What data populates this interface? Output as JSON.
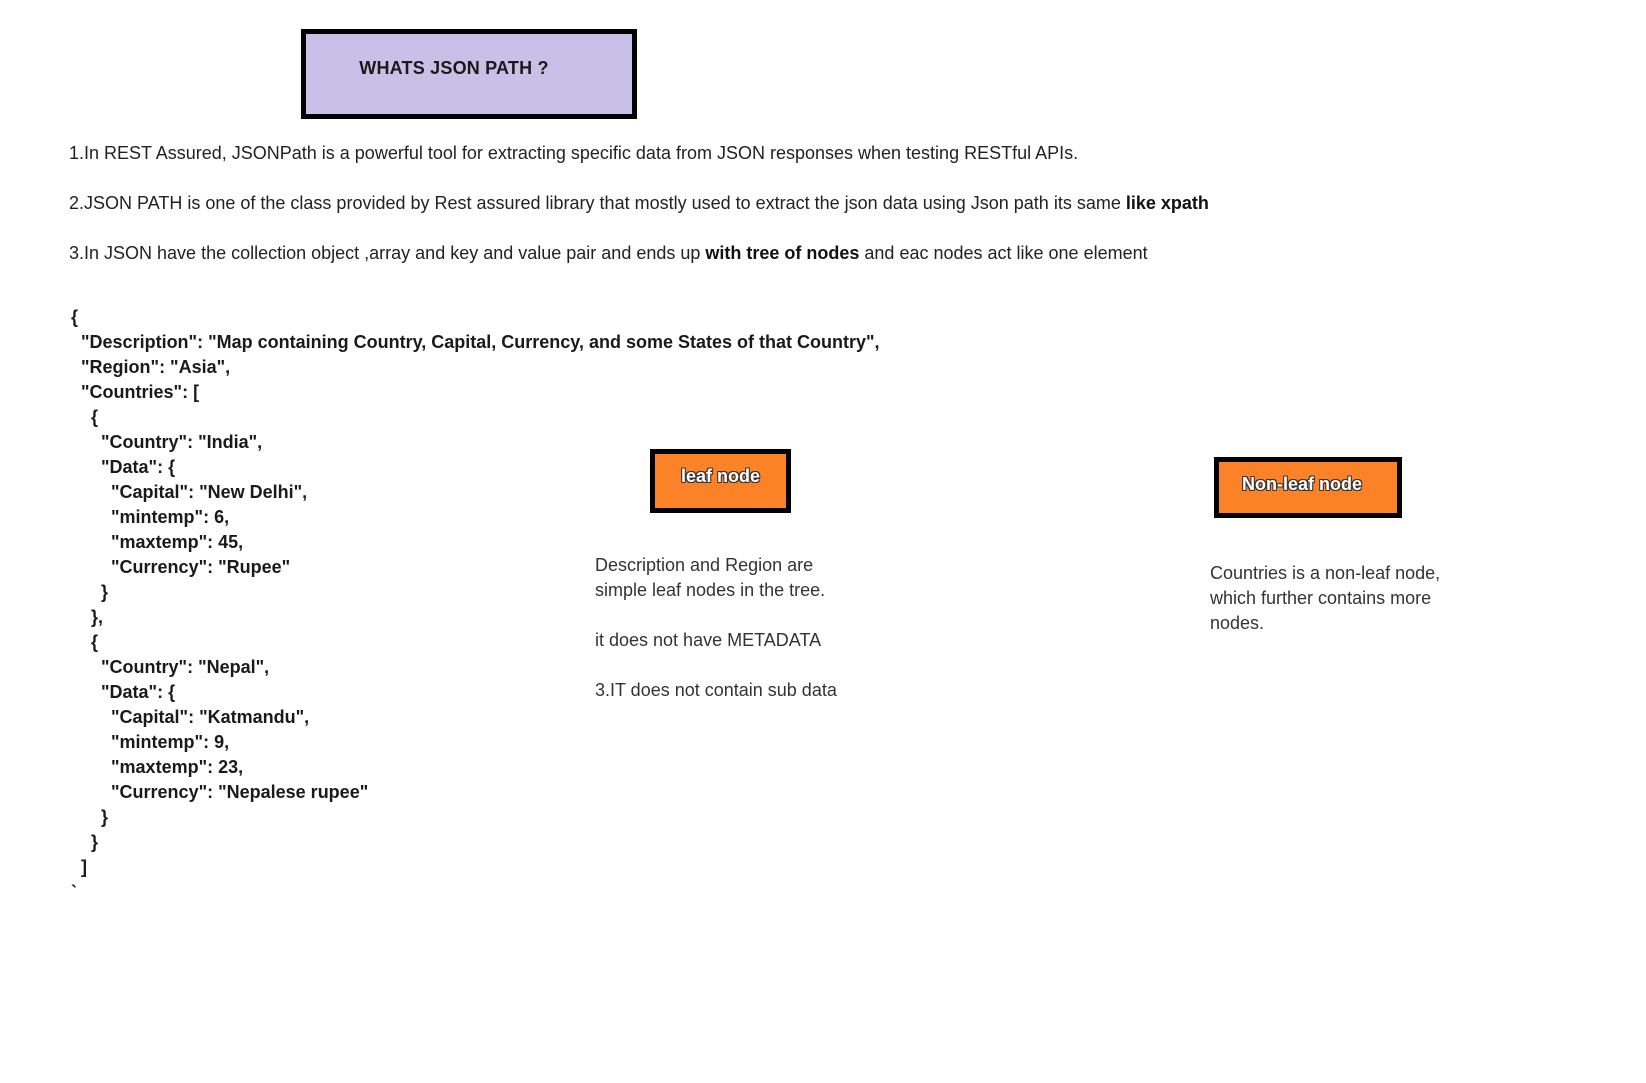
{
  "title": "WHATS JSON PATH ?",
  "points": {
    "p1": "1.In REST Assured, JSONPath is a powerful tool for extracting specific data from JSON responses when testing RESTful APIs.",
    "p2_text": "2.JSON PATH is one of the class provided by Rest assured library that mostly used to extract the json data  using Json path its same ",
    "p2_bold": "like xpath",
    "p3_pre": "3.In JSON have the collection object ,array and key and value pair and ends up ",
    "p3_bold": "with tree of nodes",
    "p3_post": " and eac  nodes act like one element"
  },
  "json_example": "{\n  \"Description\": \"Map containing Country, Capital, Currency, and some States of that Country\",\n  \"Region\": \"Asia\",\n  \"Countries\": [\n    {\n      \"Country\": \"India\",\n      \"Data\": {\n        \"Capital\": \"New Delhi\",\n        \"mintemp\": 6,\n        \"maxtemp\": 45,\n        \"Currency\": \"Rupee\"\n      }\n    },\n    {\n      \"Country\": \"Nepal\",\n      \"Data\": {\n        \"Capital\": \"Katmandu\",\n        \"mintemp\": 9,\n        \"maxtemp\": 23,\n        \"Currency\": \"Nepalese rupee\"\n      }\n    }\n  ]\n`",
  "leaf": {
    "label": "leaf node",
    "line1": "Description and Region are",
    "line2": "simple leaf nodes in the tree.",
    "line3": "it does not have METADATA",
    "line4": "3.IT does not contain sub data"
  },
  "nonleaf": {
    "label": "Non-leaf node",
    "line1": "Countries is a non-leaf node,",
    "line2": "which further contains more",
    "line3": "nodes."
  },
  "colors": {
    "title_box": "#c8c0e6",
    "node_box": "#fb8226",
    "border": "#000000"
  }
}
